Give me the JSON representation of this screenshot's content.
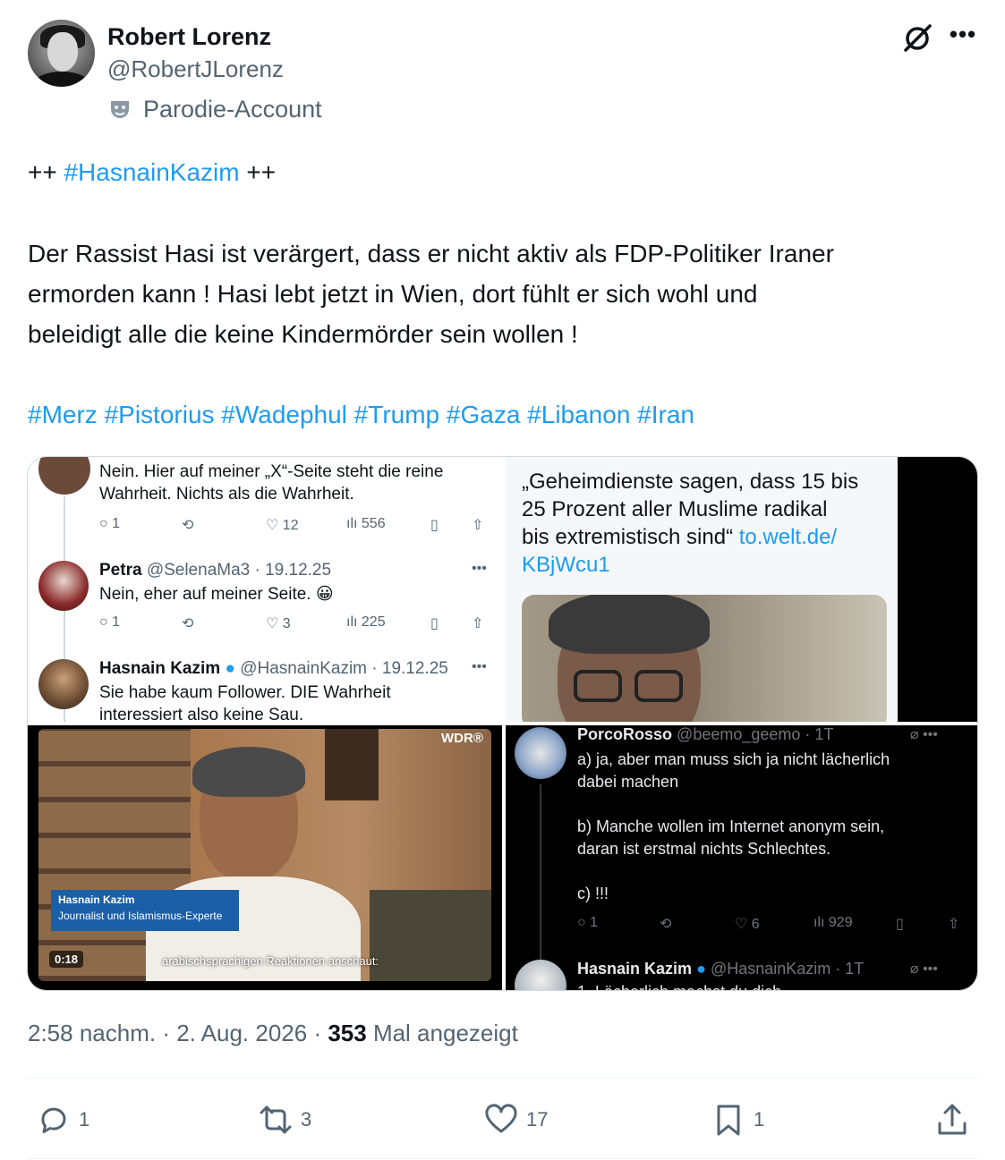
{
  "author": {
    "display_name": "Robert Lorenz",
    "handle": "@RobertJLorenz",
    "badge_label": "Parodie-Account"
  },
  "tweet": {
    "line1_prefix": "++ ",
    "line1_hashtag": "#HasnainKazim",
    "line1_suffix": " ++",
    "body_lines": [
      "Der Rassist Hasi ist verärgert, dass er nicht aktiv als FDP-Politiker Iraner",
      "ermorden kann ! Hasi lebt jetzt in Wien, dort fühlt er sich wohl und",
      "beleidigt alle die keine Kindermörder sein wollen !"
    ],
    "hashtags": "#Merz #Pistorius #Wadephul #Trump #Gaza #Libanon #Iran"
  },
  "media": {
    "img1": {
      "top_text_1": "Nein. Hier auf meiner „X“-Seite steht die reine",
      "top_text_2": "Wahrheit. Nichts als die Wahrheit.",
      "row1": {
        "replies": "1",
        "likes": "12",
        "views": "556"
      },
      "reply2_name": "Petra",
      "reply2_meta": "@SelenaMa3 · 19.12.25",
      "reply2_text": "Nein, eher auf meiner Seite. 😀",
      "row2": {
        "replies": "1",
        "likes": "3",
        "views": "225"
      },
      "reply3_name": "Hasnain Kazim",
      "reply3_meta": "@HasnainKazim · 19.12.25",
      "reply3_text_1": "Sie habe kaum Follower. DIE Wahrheit",
      "reply3_text_2": "interessiert also keine Sau."
    },
    "img2": {
      "quote_1": "„Geheimdienste sagen, dass 15 bis",
      "quote_2": "25 Prozent aller Muslime radikal",
      "quote_3_text": "bis extremistisch sind“ ",
      "quote_3_link": "to.welt.de/",
      "quote_4_link": "KBjWcu1"
    },
    "img3": {
      "channel_logo": "WDR®",
      "lower_third_name": "Hasnain Kazim",
      "lower_third_title": "Journalist und Islamismus-Experte",
      "subtitle": "arabischsprachigen Reaktionen anschaut:",
      "duration": "0:18"
    },
    "img4": {
      "name": "PorcoRosso",
      "meta": "@beemo_geemo · 1T",
      "text_a1": "a) ja, aber man muss sich ja nicht lächerlich",
      "text_a2": "dabei machen",
      "text_b1": "b) Manche wollen im Internet anonym sein,",
      "text_b2": "daran ist erstmal nichts Schlechtes.",
      "text_c": "c) !!!",
      "row": {
        "replies": "1",
        "likes": "6",
        "views": "929"
      },
      "reply_name": "Hasnain Kazim",
      "reply_meta": "@HasnainKazim · 1T",
      "reply_cut": "1. Lächerlich machst du dich"
    }
  },
  "footer": {
    "time": "2:58 nachm. · 2. Aug. 2026 · ",
    "views_count": "353",
    "views_label": " Mal angezeigt"
  },
  "actions": {
    "replies": "1",
    "reposts": "3",
    "likes": "17",
    "bookmarks": "1"
  },
  "colors": {
    "accent": "#1d9bf0",
    "muted": "#536471",
    "text": "#0f1419"
  }
}
